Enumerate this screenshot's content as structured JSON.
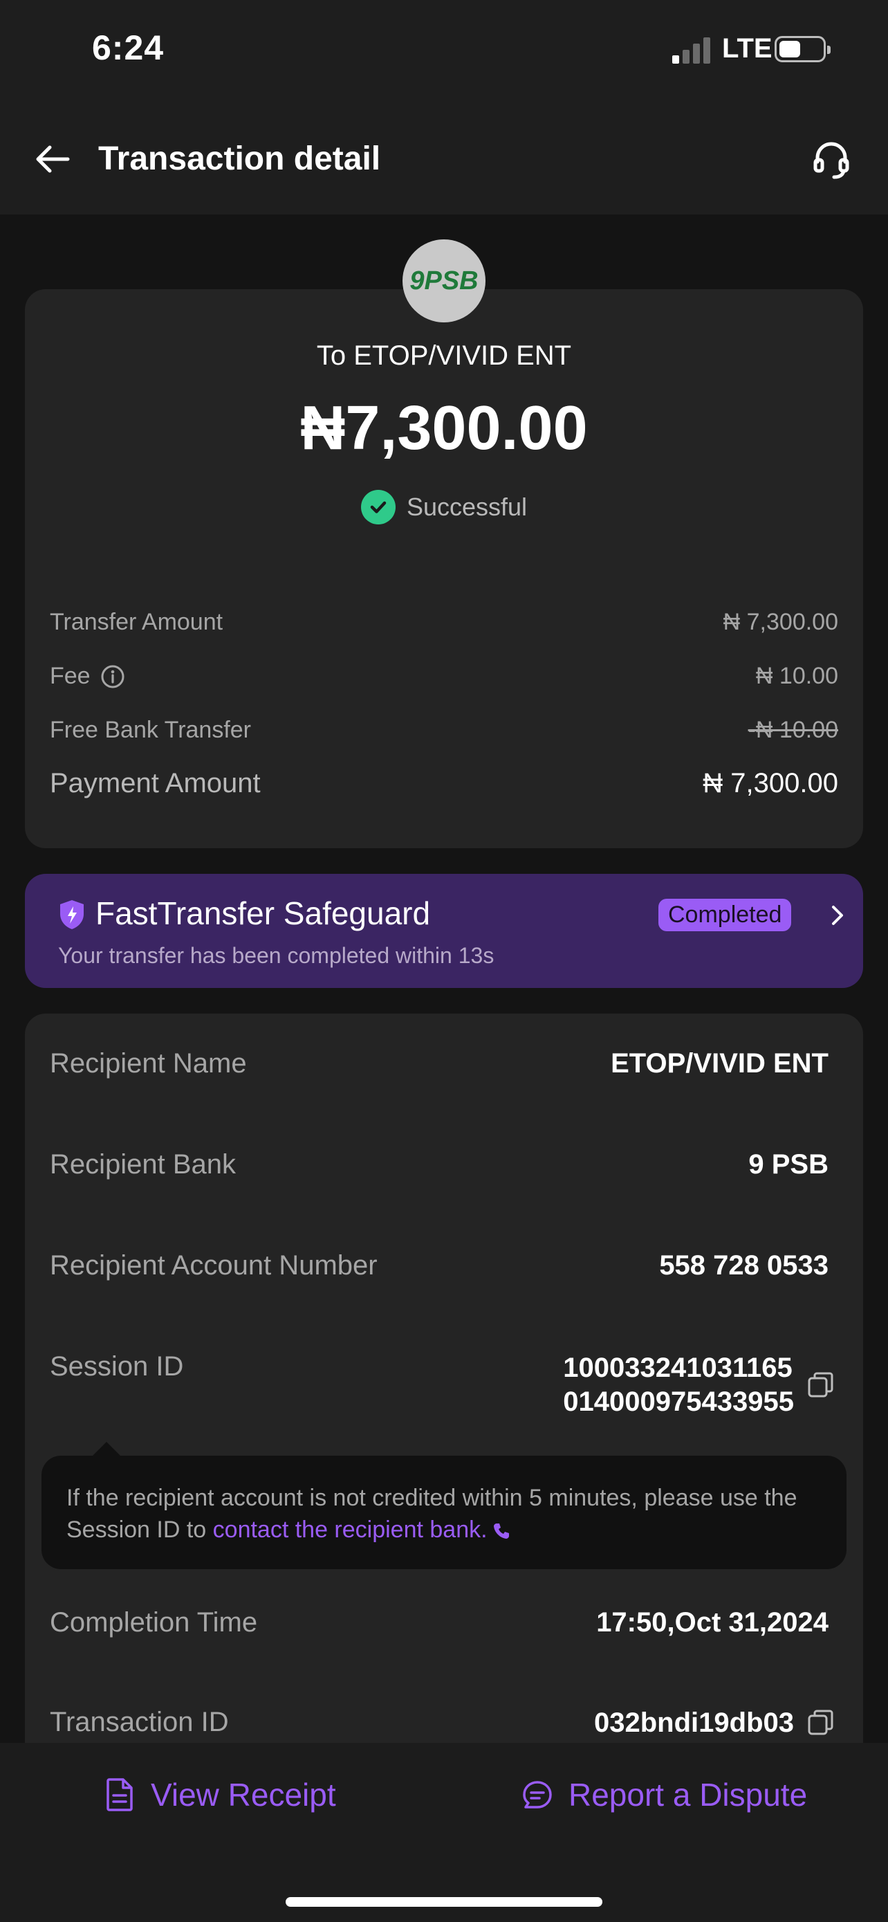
{
  "status_bar": {
    "time": "6:24",
    "network": "LTE"
  },
  "header": {
    "title": "Transaction detail",
    "back_icon": "arrow-left-icon",
    "support_icon": "headset-icon"
  },
  "summary": {
    "bank_logo_text": "9PSB",
    "recipient_line": "To ETOP/VIVID ENT",
    "amount": "₦7,300.00",
    "status": "Successful",
    "status_color": "#2fca8a",
    "rows": {
      "transfer_amount_label": "Transfer Amount",
      "transfer_amount_value": "₦ 7,300.00",
      "fee_label": "Fee",
      "fee_value": "₦ 10.00",
      "free_transfer_label": "Free Bank Transfer",
      "free_transfer_value": "-₦ 10.00",
      "payment_amount_label": "Payment Amount",
      "payment_amount_value": "₦ 7,300.00"
    }
  },
  "safeguard": {
    "title": "FastTransfer Safeguard",
    "badge": "Completed",
    "subtitle": "Your transfer has been completed within 13s",
    "accent": "#9a5cf5"
  },
  "details": {
    "recipient_name_label": "Recipient Name",
    "recipient_name_value": "ETOP/VIVID ENT",
    "recipient_bank_label": "Recipient Bank",
    "recipient_bank_value": "9 PSB",
    "account_number_label": "Recipient Account Number",
    "account_number_value": "558 728 0533",
    "session_id_label": "Session ID",
    "session_id_line1": "100033241031165",
    "session_id_line2": "014000975433955",
    "completion_time_label": "Completion Time",
    "completion_time_value": "17:50,Oct 31,2024",
    "transaction_id_label": "Transaction ID",
    "transaction_id_value": "032bndi19db03"
  },
  "tooltip": {
    "line1": "If the recipient account is not credited within 5 minutes, please use the",
    "line2_prefix": "Session ID to ",
    "line2_link": "contact the recipient bank."
  },
  "bottom": {
    "view_receipt": "View Receipt",
    "report_dispute": "Report a Dispute"
  }
}
